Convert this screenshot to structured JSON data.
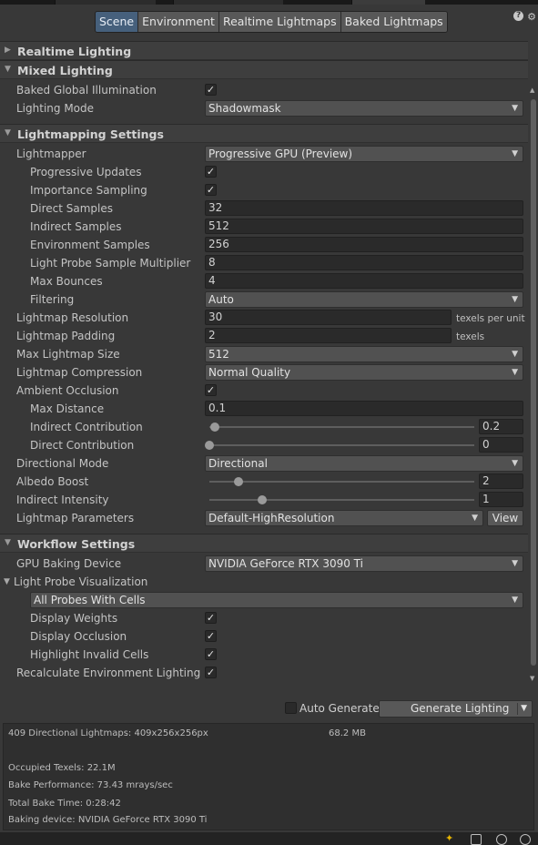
{
  "header": {
    "tabs": [
      "Scene",
      "Environment",
      "Realtime Lightmaps",
      "Baked Lightmaps"
    ],
    "active_tab": 0
  },
  "sections": {
    "realtime_lighting": "Realtime Lighting",
    "mixed_lighting": "Mixed Lighting",
    "lightmapping_settings": "Lightmapping Settings",
    "workflow_settings": "Workflow Settings"
  },
  "mixed": {
    "baked_gi_label": "Baked Global Illumination",
    "baked_gi": true,
    "lighting_mode_label": "Lighting Mode",
    "lighting_mode": "Shadowmask"
  },
  "lightmapping": {
    "lightmapper_label": "Lightmapper",
    "lightmapper": "Progressive GPU (Preview)",
    "progressive_updates_label": "Progressive Updates",
    "importance_sampling_label": "Importance Sampling",
    "direct_samples_label": "Direct Samples",
    "direct_samples": "32",
    "indirect_samples_label": "Indirect Samples",
    "indirect_samples": "512",
    "environment_samples_label": "Environment Samples",
    "environment_samples": "256",
    "probe_multiplier_label": "Light Probe Sample Multiplier",
    "probe_multiplier": "8",
    "max_bounces_label": "Max Bounces",
    "max_bounces": "4",
    "filtering_label": "Filtering",
    "filtering": "Auto",
    "resolution_label": "Lightmap Resolution",
    "resolution": "30",
    "resolution_unit": "texels per unit",
    "padding_label": "Lightmap Padding",
    "padding": "2",
    "padding_unit": "texels",
    "max_size_label": "Max Lightmap Size",
    "max_size": "512",
    "compression_label": "Lightmap Compression",
    "compression": "Normal Quality",
    "ao_label": "Ambient Occlusion",
    "max_distance_label": "Max Distance",
    "max_distance": "0.1",
    "indirect_contribution_label": "Indirect Contribution",
    "indirect_contribution": "0.2",
    "indirect_contribution_level": 0.02,
    "direct_contribution_label": "Direct Contribution",
    "direct_contribution": "0",
    "direct_contribution_level": 0,
    "directional_mode_label": "Directional Mode",
    "directional_mode": "Directional",
    "albedo_boost_label": "Albedo Boost",
    "albedo_boost": "2",
    "albedo_boost_level": 0.11,
    "indirect_intensity_label": "Indirect Intensity",
    "indirect_intensity": "1",
    "indirect_intensity_level": 0.2,
    "parameters_label": "Lightmap Parameters",
    "parameters": "Default-HighResolution",
    "view_button": "View"
  },
  "workflow": {
    "gpu_device_label": "GPU Baking Device",
    "gpu_device": "NVIDIA GeForce RTX 3090 Ti",
    "probe_vis_label": "Light Probe Visualization",
    "probe_vis": "All Probes With Cells",
    "display_weights_label": "Display Weights",
    "display_occlusion_label": "Display Occlusion",
    "highlight_invalid_label": "Highlight Invalid Cells",
    "recalc_env_label": "Recalculate Environment Lighting"
  },
  "generate": {
    "auto_generate_label": "Auto Generate",
    "auto_generate": false,
    "generate_button": "Generate Lighting"
  },
  "stats": {
    "lightmaps": "409 Directional Lightmaps: 409x256x256px",
    "size": "68.2 MB",
    "occupied": "Occupied Texels: 22.1M",
    "performance": "Bake Performance: 73.43 mrays/sec",
    "total_time": "Total Bake Time: 0:28:42",
    "device": "Baking device: NVIDIA GeForce RTX 3090 Ti"
  },
  "colors": {
    "background": "#383838",
    "active_tab": "#46607c",
    "field": "#2a2a2a",
    "dropdown": "#515151"
  }
}
